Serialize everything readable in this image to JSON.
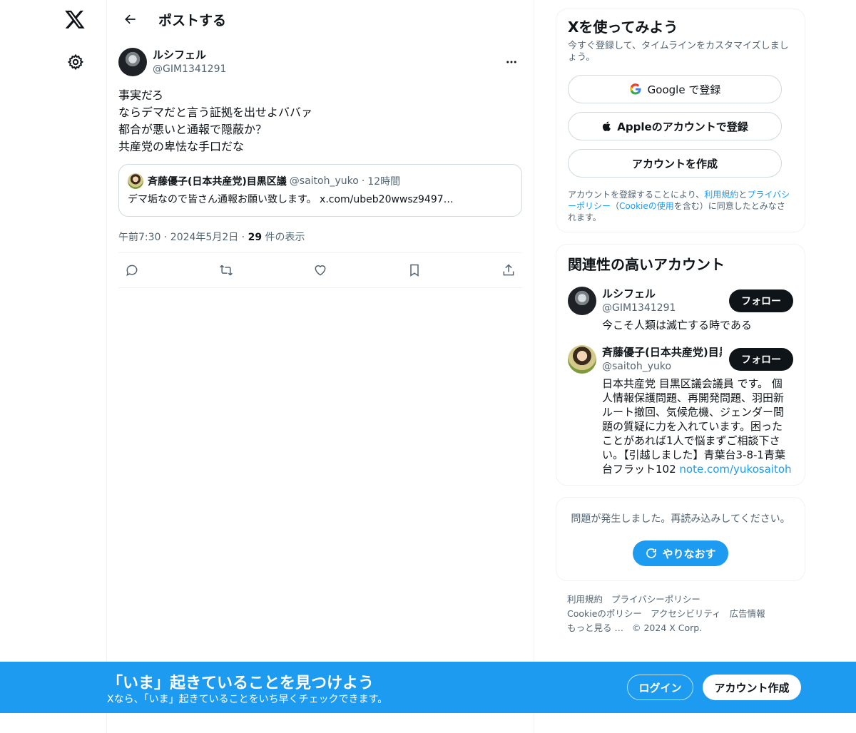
{
  "header": {
    "title": "ポストする"
  },
  "post": {
    "author_name": "ルシフェル",
    "author_handle": "@GIM1341291",
    "lines": [
      "事実だろ",
      "ならデマだと言う証拠を出せよババァ",
      "都合が悪いと通報で隠蔽か？",
      "共産党の卑怯な手口だな"
    ],
    "quote": {
      "name": "斉藤優子(日本共産党)目黒区議",
      "handle": "@saitoh_yuko",
      "time": "12時間",
      "body": "デマ垢なので皆さん通報お願い致します。 x.com/ubeb20wwsz9497…"
    },
    "timestamp": "午前7:30 · 2024年5月2日 · ",
    "views_count": "29",
    "views_label": " 件の表示"
  },
  "signup": {
    "title": "Xを使ってみよう",
    "subtitle": "今すぐ登録して、タイムラインをカスタマイズしましょう。",
    "google_label": "Google で登録",
    "apple_label": "Appleのアカウントで登録",
    "create_label": "アカウントを作成",
    "terms_pre": "アカウントを登録することにより、",
    "terms_link1": "利用規約",
    "terms_and": "と",
    "terms_link2": "プライバシーポリシー",
    "terms_paren_open": "（",
    "terms_link3": "Cookieの使用",
    "terms_post": "を含む）に同意したとみなされます。"
  },
  "related": {
    "title": "関連性の高いアカウント",
    "follow_label": "フォロー",
    "accounts": [
      {
        "name": "ルシフェル",
        "handle": "@GIM1341291",
        "bio": "今こそ人類は滅亡する時である",
        "bio_link": ""
      },
      {
        "name": "斉藤優子(日本共産党)目黒区議",
        "handle": "@saitoh_yuko",
        "bio": "日本共産党 目黒区議会議員 です。 個人情報保護問題、再開発問題、羽田新ルート撤回、気候危機、ジェンダー問題の質疑に力を入れています。困ったことがあれば1人で悩まずご相談下さい。【引越しました】青葉台3-8-1青葉台フラット102 ",
        "bio_link": "note.com/yukosaitoh"
      }
    ]
  },
  "error": {
    "text": "問題が発生しました。再読み込みしてください。",
    "retry_label": "やりなおす"
  },
  "footer": {
    "links": [
      "利用規約",
      "プライバシーポリシー",
      "Cookieのポリシー",
      "アクセシビリティ",
      "広告情報",
      "もっと見る …"
    ],
    "copyright": "© 2024 X Corp."
  },
  "banner": {
    "title": "「いま」起きていることを見つけよう",
    "subtitle": "Xなら、「いま」起きていることをいち早くチェックできます。",
    "login_label": "ログイン",
    "signup_label": "アカウント作成"
  },
  "colors": {
    "accent": "#1d9bf0",
    "text": "#0f1419",
    "muted": "#536471"
  }
}
